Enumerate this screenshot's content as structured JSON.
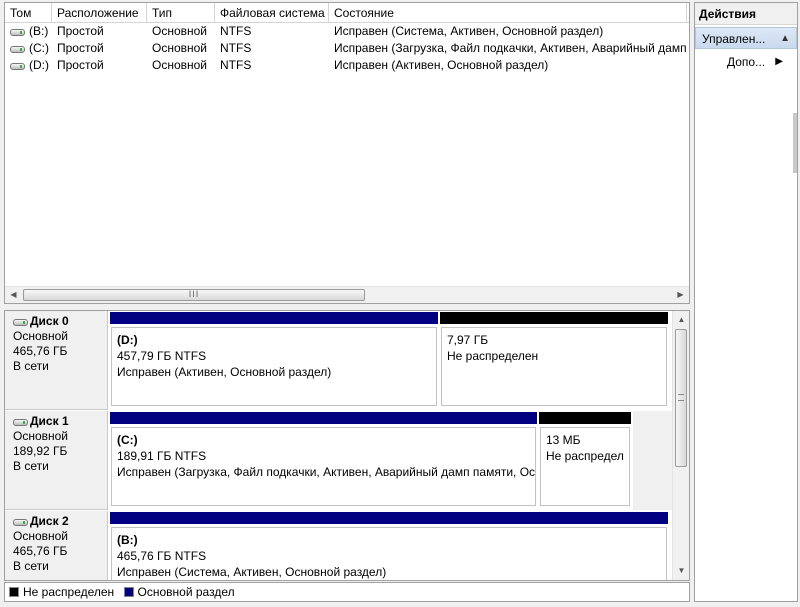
{
  "volume_list": {
    "columns": [
      "Том",
      "Расположение",
      "Тип",
      "Файловая система",
      "Состояние"
    ],
    "rows": [
      {
        "volume": "(B:)",
        "layout": "Простой",
        "type": "Основной",
        "fs": "NTFS",
        "status": "Исправен (Система, Активен, Основной раздел)"
      },
      {
        "volume": "(C:)",
        "layout": "Простой",
        "type": "Основной",
        "fs": "NTFS",
        "status": "Исправен (Загрузка, Файл подкачки, Активен, Аварийный дамп п"
      },
      {
        "volume": "(D:)",
        "layout": "Простой",
        "type": "Основной",
        "fs": "NTFS",
        "status": "Исправен (Активен, Основной раздел)"
      }
    ],
    "scroll_grip": "III"
  },
  "disks": [
    {
      "name": "Диск 0",
      "kind": "Основной",
      "size": "465,76 ГБ",
      "state": "В сети",
      "partitions": [
        {
          "title": "(D:)",
          "size_fs": "457,79 ГБ NTFS",
          "status": "Исправен (Активен, Основной раздел)"
        },
        {
          "title": "",
          "size_fs": "7,97 ГБ",
          "status": "Не распределен"
        }
      ]
    },
    {
      "name": "Диск 1",
      "kind": "Основной",
      "size": "189,92 ГБ",
      "state": "В сети",
      "partitions": [
        {
          "title": "(C:)",
          "size_fs": "189,91 ГБ NTFS",
          "status": "Исправен (Загрузка, Файл подкачки, Активен, Аварийный дамп памяти, Ос"
        },
        {
          "title": "",
          "size_fs": "13 МБ",
          "status": "Не распредел"
        }
      ]
    },
    {
      "name": "Диск 2",
      "kind": "Основной",
      "size": "465,76 ГБ",
      "state": "В сети",
      "partitions": [
        {
          "title": "(B:)",
          "size_fs": "465,76 ГБ NTFS",
          "status": "Исправен (Система, Активен, Основной раздел)"
        }
      ]
    }
  ],
  "legend": {
    "unallocated": "Не распределен",
    "primary": "Основной раздел",
    "colors": {
      "unallocated": "#000000",
      "primary": "#000080"
    }
  },
  "actions": {
    "title": "Действия",
    "section": "Управлен...",
    "more": "Допо..."
  }
}
